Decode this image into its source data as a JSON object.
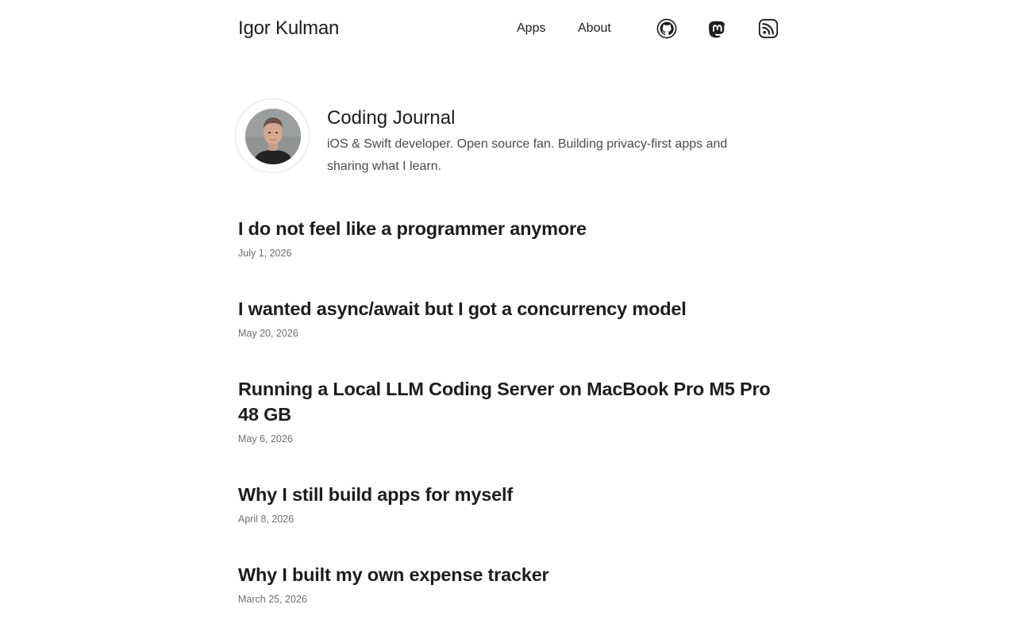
{
  "header": {
    "site_title": "Igor Kulman",
    "nav": [
      {
        "label": "Apps"
      },
      {
        "label": "About"
      }
    ],
    "social_icons": [
      "github-icon",
      "mastodon-icon",
      "rss-icon"
    ]
  },
  "profile": {
    "title": "Coding Journal",
    "description": "iOS & Swift developer. Open source fan. Building privacy-first apps and sharing what I learn."
  },
  "posts": [
    {
      "title": "I do not feel like a programmer anymore",
      "date": "July 1, 2026"
    },
    {
      "title": "I wanted async/await but I got a concurrency model",
      "date": "May 20, 2026"
    },
    {
      "title": "Running a Local LLM Coding Server on MacBook Pro M5 Pro 48 GB",
      "date": "May 6, 2026"
    },
    {
      "title": "Why I still build apps for myself",
      "date": "April 8, 2026"
    },
    {
      "title": "Why I built my own expense tracker",
      "date": "March 25, 2026"
    }
  ],
  "colors": {
    "text": "#1d1d1f",
    "secondary_text": "#6e6e73",
    "background": "#ffffff"
  }
}
